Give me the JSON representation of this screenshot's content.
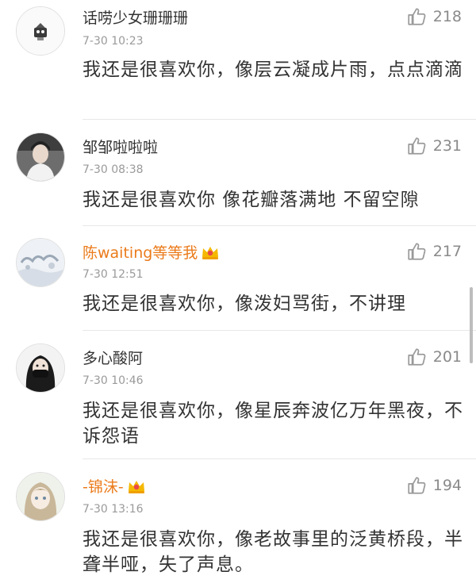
{
  "comments": [
    {
      "user": "话唠少女珊珊珊",
      "time": "7-30 10:23",
      "likes": "218",
      "text": "我还是很喜欢你，像层云凝成片雨，点点滴滴",
      "vip": false,
      "avatar": "cartoon-avatar"
    },
    {
      "user": "邹邹啦啦啦",
      "time": "7-30 08:38",
      "likes": "231",
      "text": "我还是很喜欢你 像花瓣落满地 不留空隙",
      "vip": false,
      "avatar": "portrait-avatar"
    },
    {
      "user": "陈waiting等等我",
      "time": "7-30 12:51",
      "likes": "217",
      "text": "我还是很喜欢你，像泼妇骂街，不讲理",
      "vip": true,
      "avatar": "snow-landscape-avatar"
    },
    {
      "user": "多心酸阿",
      "time": "7-30 10:46",
      "likes": "201",
      "text": "我还是很喜欢你，像星辰奔波亿万年黑夜，不诉怨语",
      "vip": false,
      "avatar": "masked-girl-avatar"
    },
    {
      "user": "-锦沫-",
      "time": "7-30 13:16",
      "likes": "194",
      "text": "我还是很喜欢你，像老故事里的泛黄桥段，半聋半哑，失了声息。",
      "vip": true,
      "avatar": "anime-girl-avatar"
    }
  ],
  "colors": {
    "vip_name": "#eb7b1b",
    "crown": "#f5b800",
    "like_icon": "#9a9a9a"
  }
}
